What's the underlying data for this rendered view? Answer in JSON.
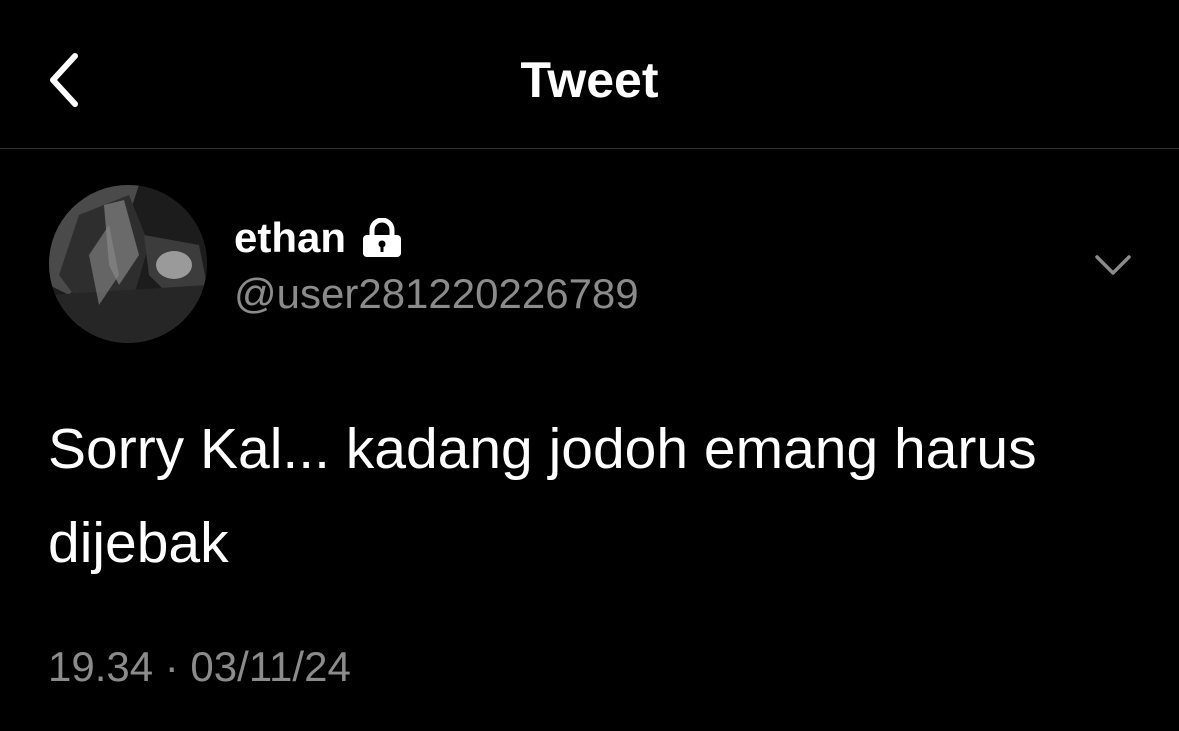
{
  "header": {
    "title": "Tweet",
    "back_icon": "chevron-left-icon"
  },
  "tweet": {
    "author": {
      "name": "ethan",
      "handle": "@user281220226789",
      "protected_icon": "lock-icon",
      "avatar_icon": "avatar"
    },
    "more_icon": "chevron-down-icon",
    "text": "Sorry Kal... kadang jodoh emang harus dijebak",
    "timestamp": "19.34 · 03/11/24"
  },
  "colors": {
    "background": "#000000",
    "primary_text": "#ffffff",
    "secondary_text": "#8b8b8b",
    "divider": "#2f3336"
  }
}
